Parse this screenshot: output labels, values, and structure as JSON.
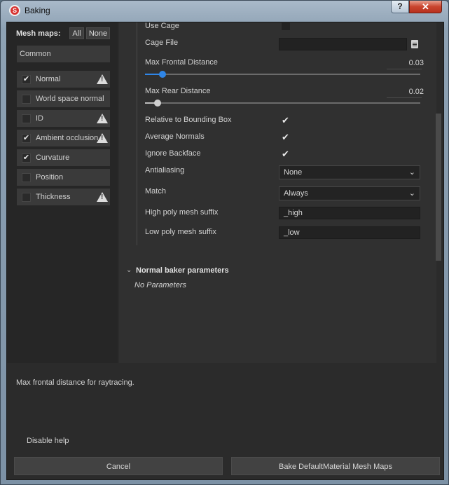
{
  "window": {
    "title": "Baking",
    "help_label": "?",
    "close_label": "✕"
  },
  "sidebar": {
    "heading": "Mesh maps:",
    "all_label": "All",
    "none_label": "None",
    "common_label": "Common",
    "items": [
      {
        "label": "Normal",
        "checked": true,
        "warning": true
      },
      {
        "label": "World space normal",
        "checked": false,
        "warning": false
      },
      {
        "label": "ID",
        "checked": false,
        "warning": true
      },
      {
        "label": "Ambient occlusion",
        "checked": true,
        "warning": true
      },
      {
        "label": "Curvature",
        "checked": true,
        "warning": false
      },
      {
        "label": "Position",
        "checked": false,
        "warning": false
      },
      {
        "label": "Thickness",
        "checked": false,
        "warning": true
      }
    ]
  },
  "params": {
    "use_cage_label": "Use Cage",
    "use_cage_checked": false,
    "cage_file_label": "Cage File",
    "cage_file_value": "",
    "max_frontal_label": "Max Frontal Distance",
    "max_frontal_value": "0.03",
    "max_frontal_level": 0.03,
    "max_rear_label": "Max Rear Distance",
    "max_rear_value": "0.02",
    "max_rear_level": 0.02,
    "relative_bbox_label": "Relative to Bounding Box",
    "relative_bbox_checked": true,
    "average_normals_label": "Average Normals",
    "average_normals_checked": true,
    "ignore_backface_label": "Ignore Backface",
    "ignore_backface_checked": true,
    "antialiasing_label": "Antialiasing",
    "antialiasing_value": "None",
    "match_label": "Match",
    "match_value": "Always",
    "high_suffix_label": "High poly mesh suffix",
    "high_suffix_value": "_high",
    "low_suffix_label": "Low poly mesh suffix",
    "low_suffix_value": "_low"
  },
  "section": {
    "title": "Normal baker parameters",
    "empty_text": "No Parameters"
  },
  "help_text": "Max frontal distance for raytracing.",
  "disable_help_label": "Disable help",
  "buttons": {
    "cancel": "Cancel",
    "bake": "Bake DefaultMaterial Mesh Maps"
  },
  "colors": {
    "accent": "#2f86e8",
    "panel": "#303030",
    "sidebar": "#262626"
  },
  "icons": {
    "check": "✔",
    "chevron": "⌄",
    "warning": "!",
    "expand": "⌄"
  }
}
